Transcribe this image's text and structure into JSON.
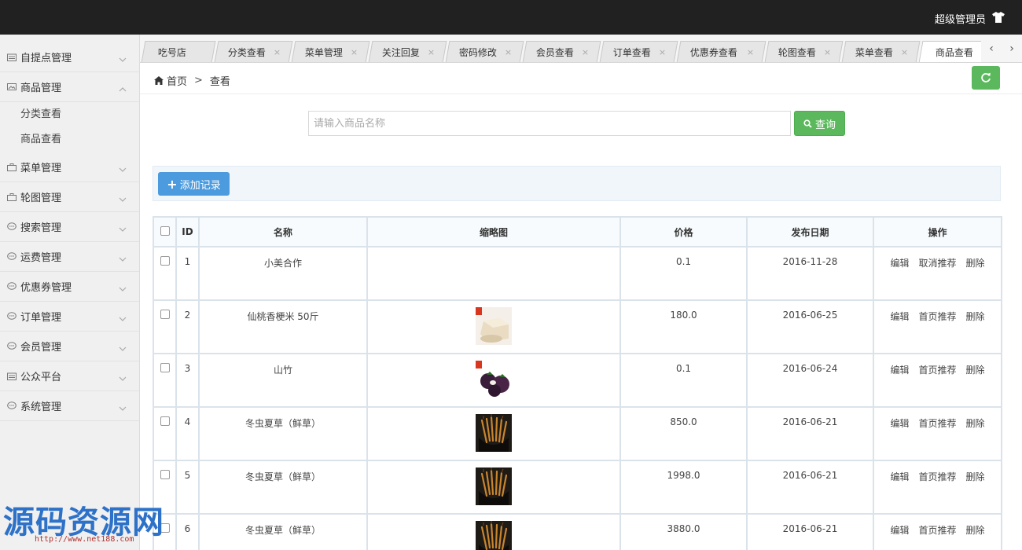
{
  "header": {
    "user_name": "超级管理员"
  },
  "sidebar": {
    "items": [
      {
        "label": "自提点管理",
        "icon": "store-icon",
        "expanded": false
      },
      {
        "label": "商品管理",
        "icon": "image-icon",
        "expanded": true,
        "children": [
          {
            "label": "分类查看"
          },
          {
            "label": "商品查看"
          }
        ]
      },
      {
        "label": "菜单管理",
        "icon": "bag-icon",
        "expanded": false
      },
      {
        "label": "轮图管理",
        "icon": "bag-icon",
        "expanded": false
      },
      {
        "label": "搜索管理",
        "icon": "chat-icon",
        "expanded": false
      },
      {
        "label": "运费管理",
        "icon": "chat-icon",
        "expanded": false
      },
      {
        "label": "优惠券管理",
        "icon": "chat-icon",
        "expanded": false
      },
      {
        "label": "订单管理",
        "icon": "chat-icon",
        "expanded": false
      },
      {
        "label": "会员管理",
        "icon": "chat-icon",
        "expanded": false
      },
      {
        "label": "公众平台",
        "icon": "store-icon",
        "expanded": false
      },
      {
        "label": "系统管理",
        "icon": "chat-icon",
        "expanded": false
      }
    ]
  },
  "tabs": [
    {
      "label": "吃号店",
      "closable": false,
      "active": false
    },
    {
      "label": "分类查看",
      "closable": true,
      "active": false
    },
    {
      "label": "菜单管理",
      "closable": true,
      "active": false
    },
    {
      "label": "关注回复",
      "closable": true,
      "active": false
    },
    {
      "label": "密码修改",
      "closable": true,
      "active": false
    },
    {
      "label": "会员查看",
      "closable": true,
      "active": false
    },
    {
      "label": "订单查看",
      "closable": true,
      "active": false
    },
    {
      "label": "优惠券查看",
      "closable": true,
      "active": false
    },
    {
      "label": "轮图查看",
      "closable": true,
      "active": false
    },
    {
      "label": "菜单查看",
      "closable": true,
      "active": false
    },
    {
      "label": "商品查看",
      "closable": false,
      "active": true
    }
  ],
  "tab_close_glyph": "×",
  "tab_nav": {
    "prev": "‹",
    "next": "›"
  },
  "breadcrumb": {
    "home": "首页",
    "separator": ">",
    "current": "查看"
  },
  "search": {
    "placeholder": "请输入商品名称",
    "value": "",
    "button_label": "查询"
  },
  "toolbar": {
    "add_label": "添加记录"
  },
  "table": {
    "columns": [
      "ID",
      "名称",
      "缩略图",
      "价格",
      "发布日期",
      "操作"
    ],
    "rows": [
      {
        "id": "1",
        "name": "小美合作",
        "thumb": "none",
        "price": "0.1",
        "date": "2016-11-28",
        "actions": [
          "编辑",
          "取消推荐",
          "删除"
        ]
      },
      {
        "id": "2",
        "name": "仙桃香梗米 50斤",
        "thumb": "rice-image",
        "price": "180.0",
        "date": "2016-06-25",
        "actions": [
          "编辑",
          "首页推荐",
          "删除"
        ]
      },
      {
        "id": "3",
        "name": "山竹",
        "thumb": "mangosteen-image",
        "price": "0.1",
        "date": "2016-06-24",
        "actions": [
          "编辑",
          "首页推荐",
          "删除"
        ]
      },
      {
        "id": "4",
        "name": "冬虫夏草（鲜草）",
        "thumb": "cordyceps-image",
        "price": "850.0",
        "date": "2016-06-21",
        "actions": [
          "编辑",
          "首页推荐",
          "删除"
        ]
      },
      {
        "id": "5",
        "name": "冬虫夏草（鲜草）",
        "thumb": "cordyceps-image",
        "price": "1998.0",
        "date": "2016-06-21",
        "actions": [
          "编辑",
          "首页推荐",
          "删除"
        ]
      },
      {
        "id": "6",
        "name": "冬虫夏草（鲜草）",
        "thumb": "cordyceps-image",
        "price": "3880.0",
        "date": "2016-06-21",
        "actions": [
          "编辑",
          "首页推荐",
          "删除"
        ]
      }
    ]
  },
  "watermark": {
    "text": "源码资源网",
    "url": "http://www.net188.com"
  },
  "colors": {
    "topbar": "#212121",
    "primary_green": "#5cb85c",
    "add_blue": "#4b9bde",
    "watermark": "#2d72c8"
  }
}
